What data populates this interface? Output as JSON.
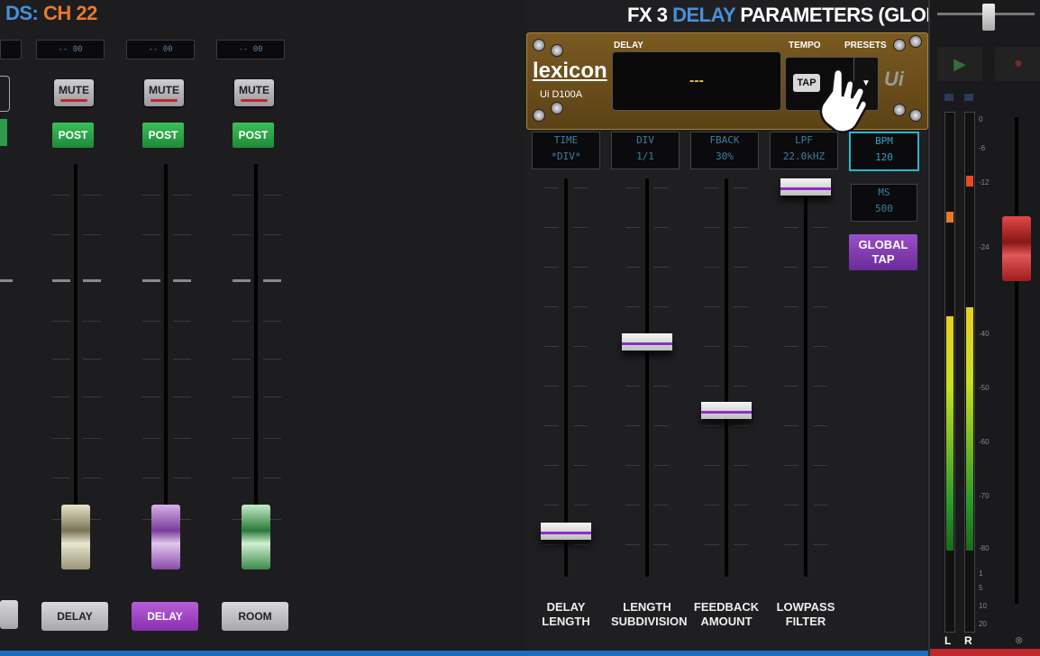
{
  "left": {
    "title_prefix": "DS:",
    "title_channel": "CH 22",
    "channels": [
      {
        "display": "-- 00",
        "mute": "MUTE",
        "post": "POST",
        "send_button": "DELAY",
        "send_active": false
      },
      {
        "display": "-- 00",
        "mute": "MUTE",
        "post": "POST",
        "send_button": "DELAY",
        "send_active": true
      },
      {
        "display": "-- 00",
        "mute": "MUTE",
        "post": "POST",
        "send_button": "ROOM",
        "send_active": false
      }
    ]
  },
  "fx": {
    "title_prefix": "FX 3",
    "title_highlight": "DELAY",
    "title_suffix": "PARAMETERS (GLOBAL)",
    "unit": {
      "brand": "lexicon",
      "model": "Ui D100A",
      "delay_label": "DELAY",
      "display_value": "---",
      "tempo_label": "TEMPO",
      "tap_label": "TAP",
      "presets_label": "PRESETS",
      "badge": "Ui"
    },
    "params": [
      {
        "name": "TIME",
        "value": "*DIV*"
      },
      {
        "name": "DIV",
        "value": "1/1"
      },
      {
        "name": "FBACK",
        "value": "30%"
      },
      {
        "name": "LPF",
        "value": "22.0kHZ"
      }
    ],
    "bpm": {
      "name": "BPM",
      "value": "120"
    },
    "ms": {
      "name": "MS",
      "value": "500"
    },
    "global_tap": "GLOBAL TAP",
    "faders": [
      {
        "line1": "DELAY",
        "line2": "LENGTH",
        "level": 0.0
      },
      {
        "line1": "LENGTH",
        "line2": "SUBDIVISION",
        "level": 0.55
      },
      {
        "line1": "FEEDBACK",
        "line2": "AMOUNT",
        "level": 0.35
      },
      {
        "line1": "LOWPASS",
        "line2": "FILTER",
        "level": 1.0
      }
    ]
  },
  "meter": {
    "scale": [
      "0",
      "-6",
      "-12",
      "-24",
      "-40",
      "-50",
      "-60",
      "-70",
      "-80"
    ],
    "bottom_scale": [
      "1",
      "5",
      "10",
      "20"
    ],
    "left_label": "L",
    "right_label": "R"
  }
}
